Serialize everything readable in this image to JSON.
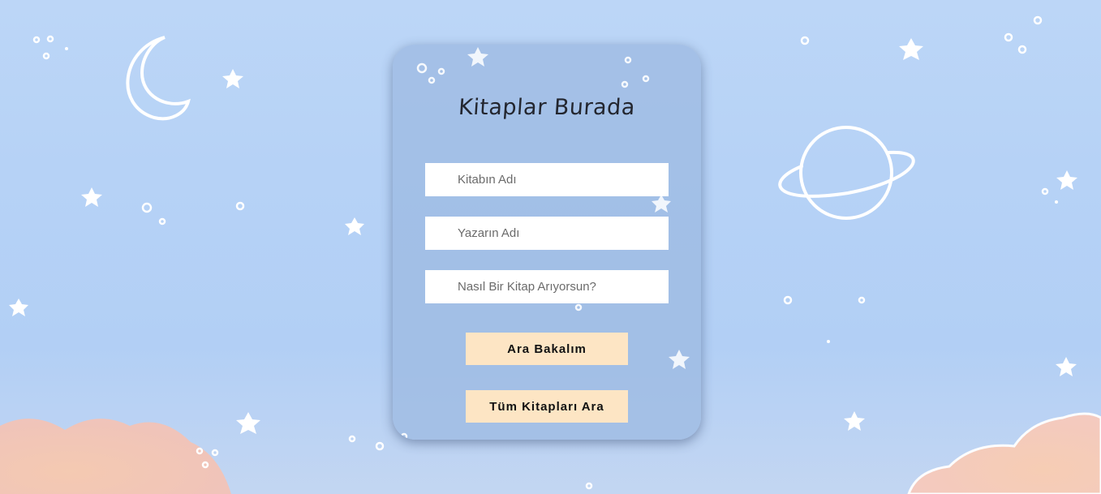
{
  "card": {
    "title": "Kitaplar Burada",
    "fields": [
      {
        "placeholder": "Kitabın Adı",
        "value": ""
      },
      {
        "placeholder": "Yazarın Adı",
        "value": ""
      },
      {
        "placeholder": "Nasıl Bir Kitap Arıyorsun?",
        "value": ""
      }
    ],
    "search_button": "Ara Bakalım",
    "search_all_button": "Tüm Kitapları Ara"
  },
  "colors": {
    "background": "#b6d2f6",
    "card": "#9bb9e1",
    "button": "#fde5c4",
    "title": "#23262f"
  }
}
